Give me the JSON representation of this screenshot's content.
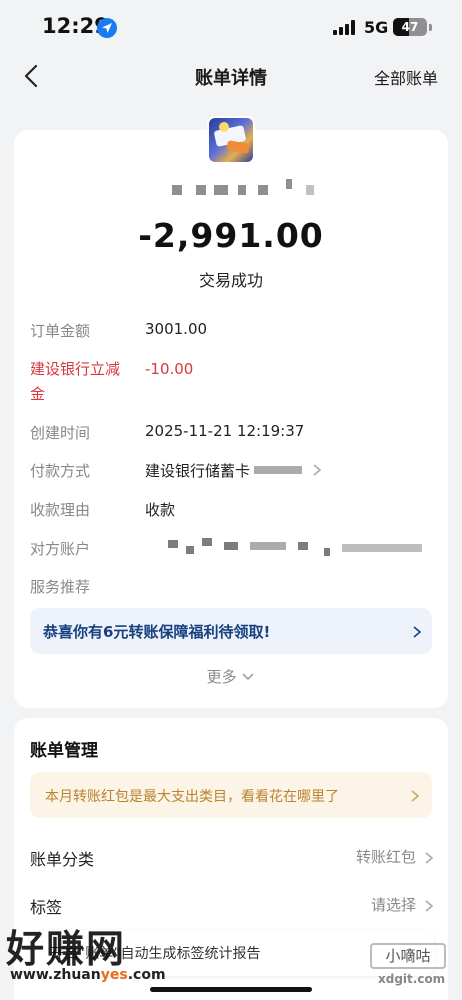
{
  "status_bar": {
    "time": "12:29",
    "network": "5G",
    "battery": "47",
    "battery_level": 0.47
  },
  "nav": {
    "title": "账单详情",
    "right_action": "全部账单"
  },
  "bill": {
    "amount": "-2,991.00",
    "status": "交易成功",
    "rows": [
      {
        "label": "订单金额",
        "value": "3001.00"
      },
      {
        "label": "建设银行立减金",
        "value": "-10.00"
      },
      {
        "label": "创建时间",
        "value": "2025-11-21 12:19:37"
      },
      {
        "label": "付款方式",
        "value": "建设银行储蓄卡"
      },
      {
        "label": "收款理由",
        "value": "收款"
      },
      {
        "label": "对方账户",
        "value": ""
      },
      {
        "label": "服务推荐",
        "value": ""
      }
    ],
    "promo_text": "恭喜你有6元转账保障福利待领取!",
    "more_label": "更多"
  },
  "manage": {
    "title": "账单管理",
    "tip_text": "本月转账红包是最大支出类目，看看花在哪里了",
    "rows": [
      {
        "label": "账单分类",
        "value": "转账红包"
      },
      {
        "label": "标签",
        "value": "请选择"
      }
    ]
  },
  "bottom_banner": {
    "text": "开启“账单”自动生成标签统计报告"
  },
  "watermark": {
    "brand": "好赚网",
    "url_prefix": "www.zhuan",
    "url_highlight": "yes",
    "url_suffix": ".com",
    "right_brand": "小嘀咕",
    "right_url": "xdgit.com"
  },
  "colors": {
    "accent_blue": "#1a7cf5",
    "discount_red": "#d9383a",
    "promo_text": "#17407f",
    "tip_text": "#b8842e"
  }
}
